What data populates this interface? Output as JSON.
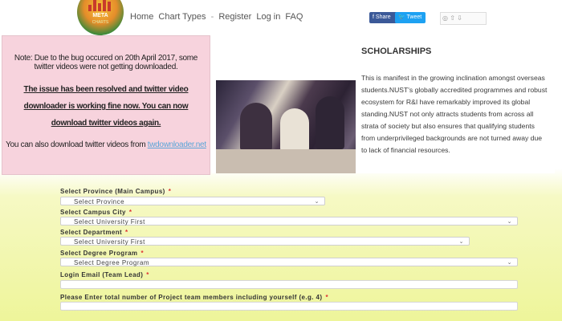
{
  "header": {
    "logo_text": "META",
    "logo_subtext": "CHARTS",
    "nav": [
      "Home",
      "Chart Types",
      "Register",
      "Log in",
      "FAQ"
    ],
    "nav_separator": "-",
    "share_label": "Share",
    "tweet_label": "Tweet",
    "social_box_text": "◎ ⇧ ⇩"
  },
  "notice": {
    "line1": "Note: Due to the bug occured on 20th April 2017, some twitter videos were not getting downloaded.",
    "line2": "The issue has been resolved and twitter video downloader is working fine now. You can now download twitter videos again.",
    "line3_prefix": "You can also download twitter videos from ",
    "line3_link": "twdownloader.net"
  },
  "scholarships": {
    "title": "SCHOLARSHIPS",
    "text": "This is manifest in the growing inclination amongst overseas students.NUST's globally accredited programmes and robust ecosystem for R&I have remarkably improved its global standing.NUST not only attracts students from across all strata of society but also ensures that qualifying students from underprivileged backgrounds are not turned away due to lack of financial resources."
  },
  "form": {
    "province_label": "Select Province (Main Campus)",
    "province_value": "Select Province",
    "city_label": "Select Campus City",
    "city_value": "Select University First",
    "department_label": "Select Department",
    "department_value": "Select University First",
    "program_label": "Select Degree Program",
    "program_value": "Select Degree Program",
    "email_label": "Login Email (Team Lead)",
    "members_label": "Please Enter total number of Project team members including yourself (e.g. 4)",
    "required_mark": "*"
  },
  "colors": {
    "notice_bg": "#f7d3dd",
    "scholarship_text": "#3a3a3a",
    "form_bg": "#eef59a",
    "share": "#3b5998",
    "tweet": "#1da1f2",
    "required": "#dd3333"
  }
}
